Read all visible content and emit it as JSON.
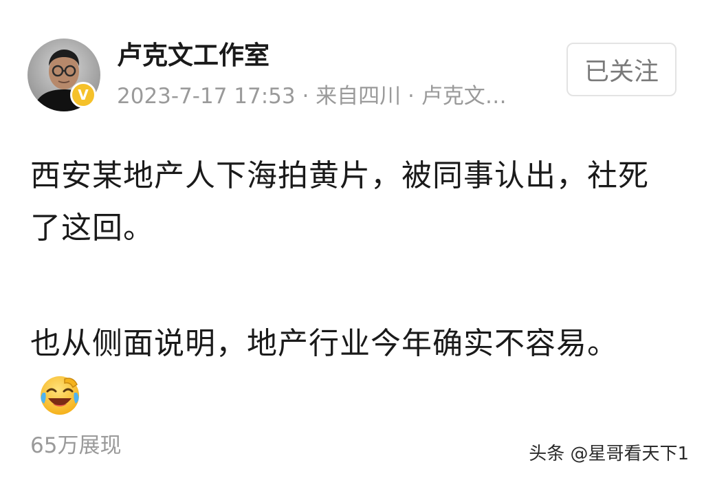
{
  "post": {
    "author": {
      "name": "卢克文工作室",
      "verified_badge": "V",
      "verified_color": "#f5c12a"
    },
    "meta": "2023-7-17 17:53 · 来自四川 · 卢克文…",
    "follow_label": "已关注",
    "paragraph_1": "西安某地产人下海拍黄片，被同事认出，社死了这回。",
    "paragraph_2": "也从侧面说明，地产行业今年确实不容易。",
    "emoji": "laughing-crying-emoji-icon",
    "views": "65万展现"
  },
  "watermark": "头条 @星哥看天下1",
  "colors": {
    "text": "#1a1a1a",
    "meta": "#9a9a9a",
    "button_border": "#e3e3e3",
    "button_text": "#7a7a7a"
  }
}
